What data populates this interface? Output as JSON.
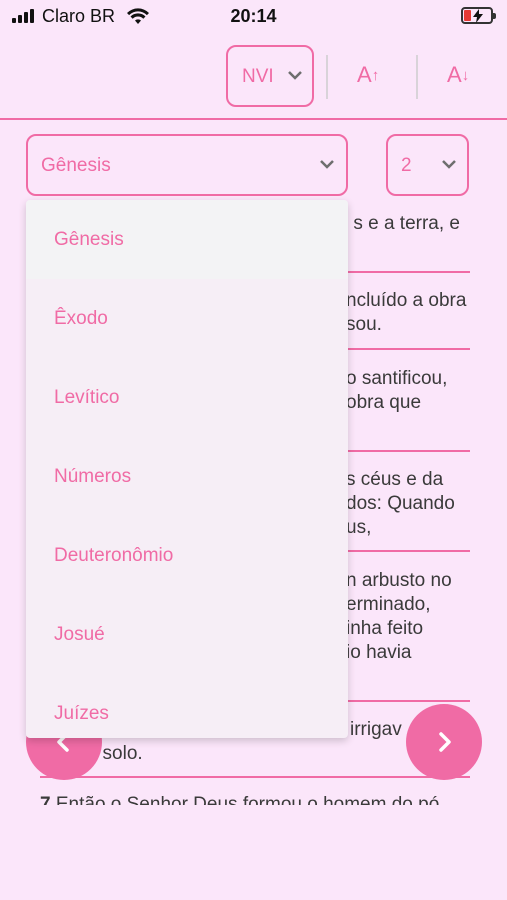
{
  "status_bar": {
    "carrier": "Claro BR",
    "time": "20:14",
    "icons": [
      "signal-icon",
      "wifi-icon",
      "battery-charging-icon"
    ]
  },
  "toolbar": {
    "version": "NVI",
    "font_increase_label": "A",
    "font_decrease_label": "A",
    "increase_arrow": "↑",
    "decrease_arrow": "↓"
  },
  "selectors": {
    "book": "Gênesis",
    "chapter": "2"
  },
  "book_options": [
    "Gênesis",
    "Êxodo",
    "Levítico",
    "Números",
    "Deuteronômio",
    "Josué",
    "Juízes"
  ],
  "verses_visible": [
    {
      "text": "s e a terra, e"
    },
    {
      "text": "ncluído a obra\nsou."
    },
    {
      "text": "o santificou,\nobra que"
    },
    {
      "text": "s céus e da\ndos: Quando\nus,"
    },
    {
      "text": "n arbusto no\nerminado,\ninha feito\nio havia"
    },
    {
      "text": "irrigav\nfície do solo."
    },
    {
      "num": "7",
      "text": "Então o Senhor Deus formou o homem do pó"
    }
  ],
  "colors": {
    "accent": "#f06ba5",
    "background": "#fbe6fa",
    "dropdown_bg": "#f6eef6"
  }
}
